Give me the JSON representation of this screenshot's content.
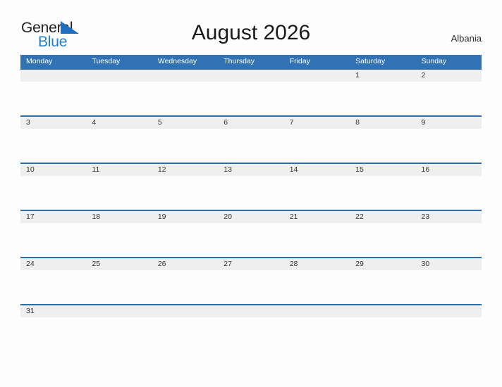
{
  "page": {
    "background_color": "#fdfdfd",
    "header_blue": "#3072b4",
    "rule_blue": "#2e6da8",
    "band_gray": "#efefef"
  },
  "logo": {
    "word_one": "General",
    "word_two": "Blue",
    "flag_icon": "blue-triangle-flag-icon",
    "word_one_color": "#231f20",
    "word_two_color": "#1f7fd0"
  },
  "header": {
    "title": "August 2026",
    "country": "Albania"
  },
  "calendar": {
    "weekdays": [
      "Monday",
      "Tuesday",
      "Wednesday",
      "Thursday",
      "Friday",
      "Saturday",
      "Sunday"
    ],
    "weeks": [
      [
        "",
        "",
        "",
        "",
        "",
        "1",
        "2"
      ],
      [
        "3",
        "4",
        "5",
        "6",
        "7",
        "8",
        "9"
      ],
      [
        "10",
        "11",
        "12",
        "13",
        "14",
        "15",
        "16"
      ],
      [
        "17",
        "18",
        "19",
        "20",
        "21",
        "22",
        "23"
      ],
      [
        "24",
        "25",
        "26",
        "27",
        "28",
        "29",
        "30"
      ],
      [
        "31",
        "",
        "",
        "",
        "",
        "",
        ""
      ]
    ]
  }
}
